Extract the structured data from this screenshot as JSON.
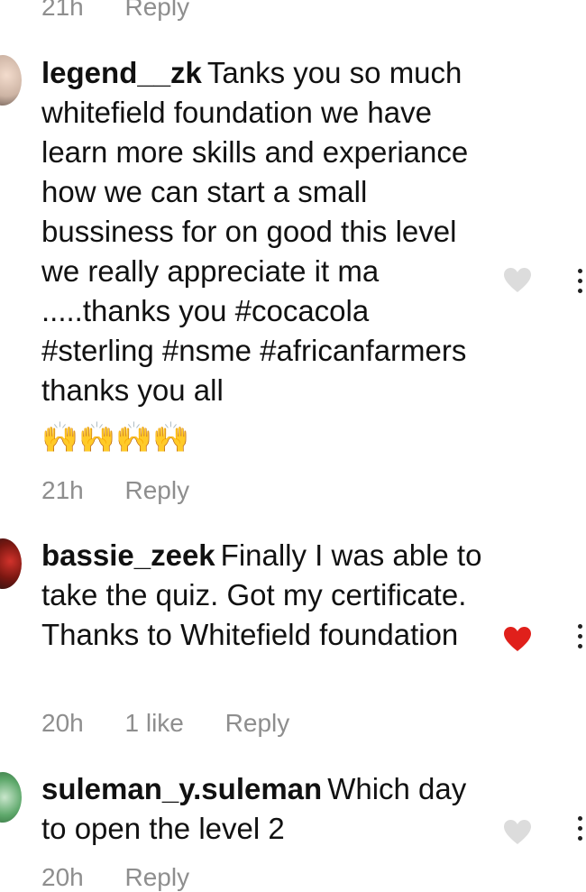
{
  "top_meta": {
    "time": "21h",
    "reply": "Reply"
  },
  "comments": [
    {
      "username": "legend__zk",
      "text": "Tanks you so much whitefield foundation we have learn more skills and experiance how we can start a small bussiness for on good this level we really appreciate it ma .....thanks you #cocacola #sterling #nsme #africanfarmers thanks you all",
      "emoji": "🙌🙌🙌🙌",
      "time": "21h",
      "likes": "",
      "reply": "Reply",
      "liked": false
    },
    {
      "username": "bassie_zeek",
      "text": "Finally I was able to take the quiz. Got my certificate. Thanks to Whitefield foundation",
      "time": "20h",
      "likes": "1 like",
      "reply": "Reply",
      "liked": true
    },
    {
      "username": "suleman_y.suleman",
      "text": "Which day to open the level 2",
      "time": "20h",
      "likes": "",
      "reply": "Reply",
      "liked": false
    }
  ],
  "colors": {
    "text": "#111111",
    "meta": "#8e8e8e",
    "heart_outline": "#dcdcdc",
    "heart_liked": "#e0201b"
  },
  "icons": [
    "heart-outline-icon",
    "heart-filled-icon",
    "more-options-icon"
  ]
}
